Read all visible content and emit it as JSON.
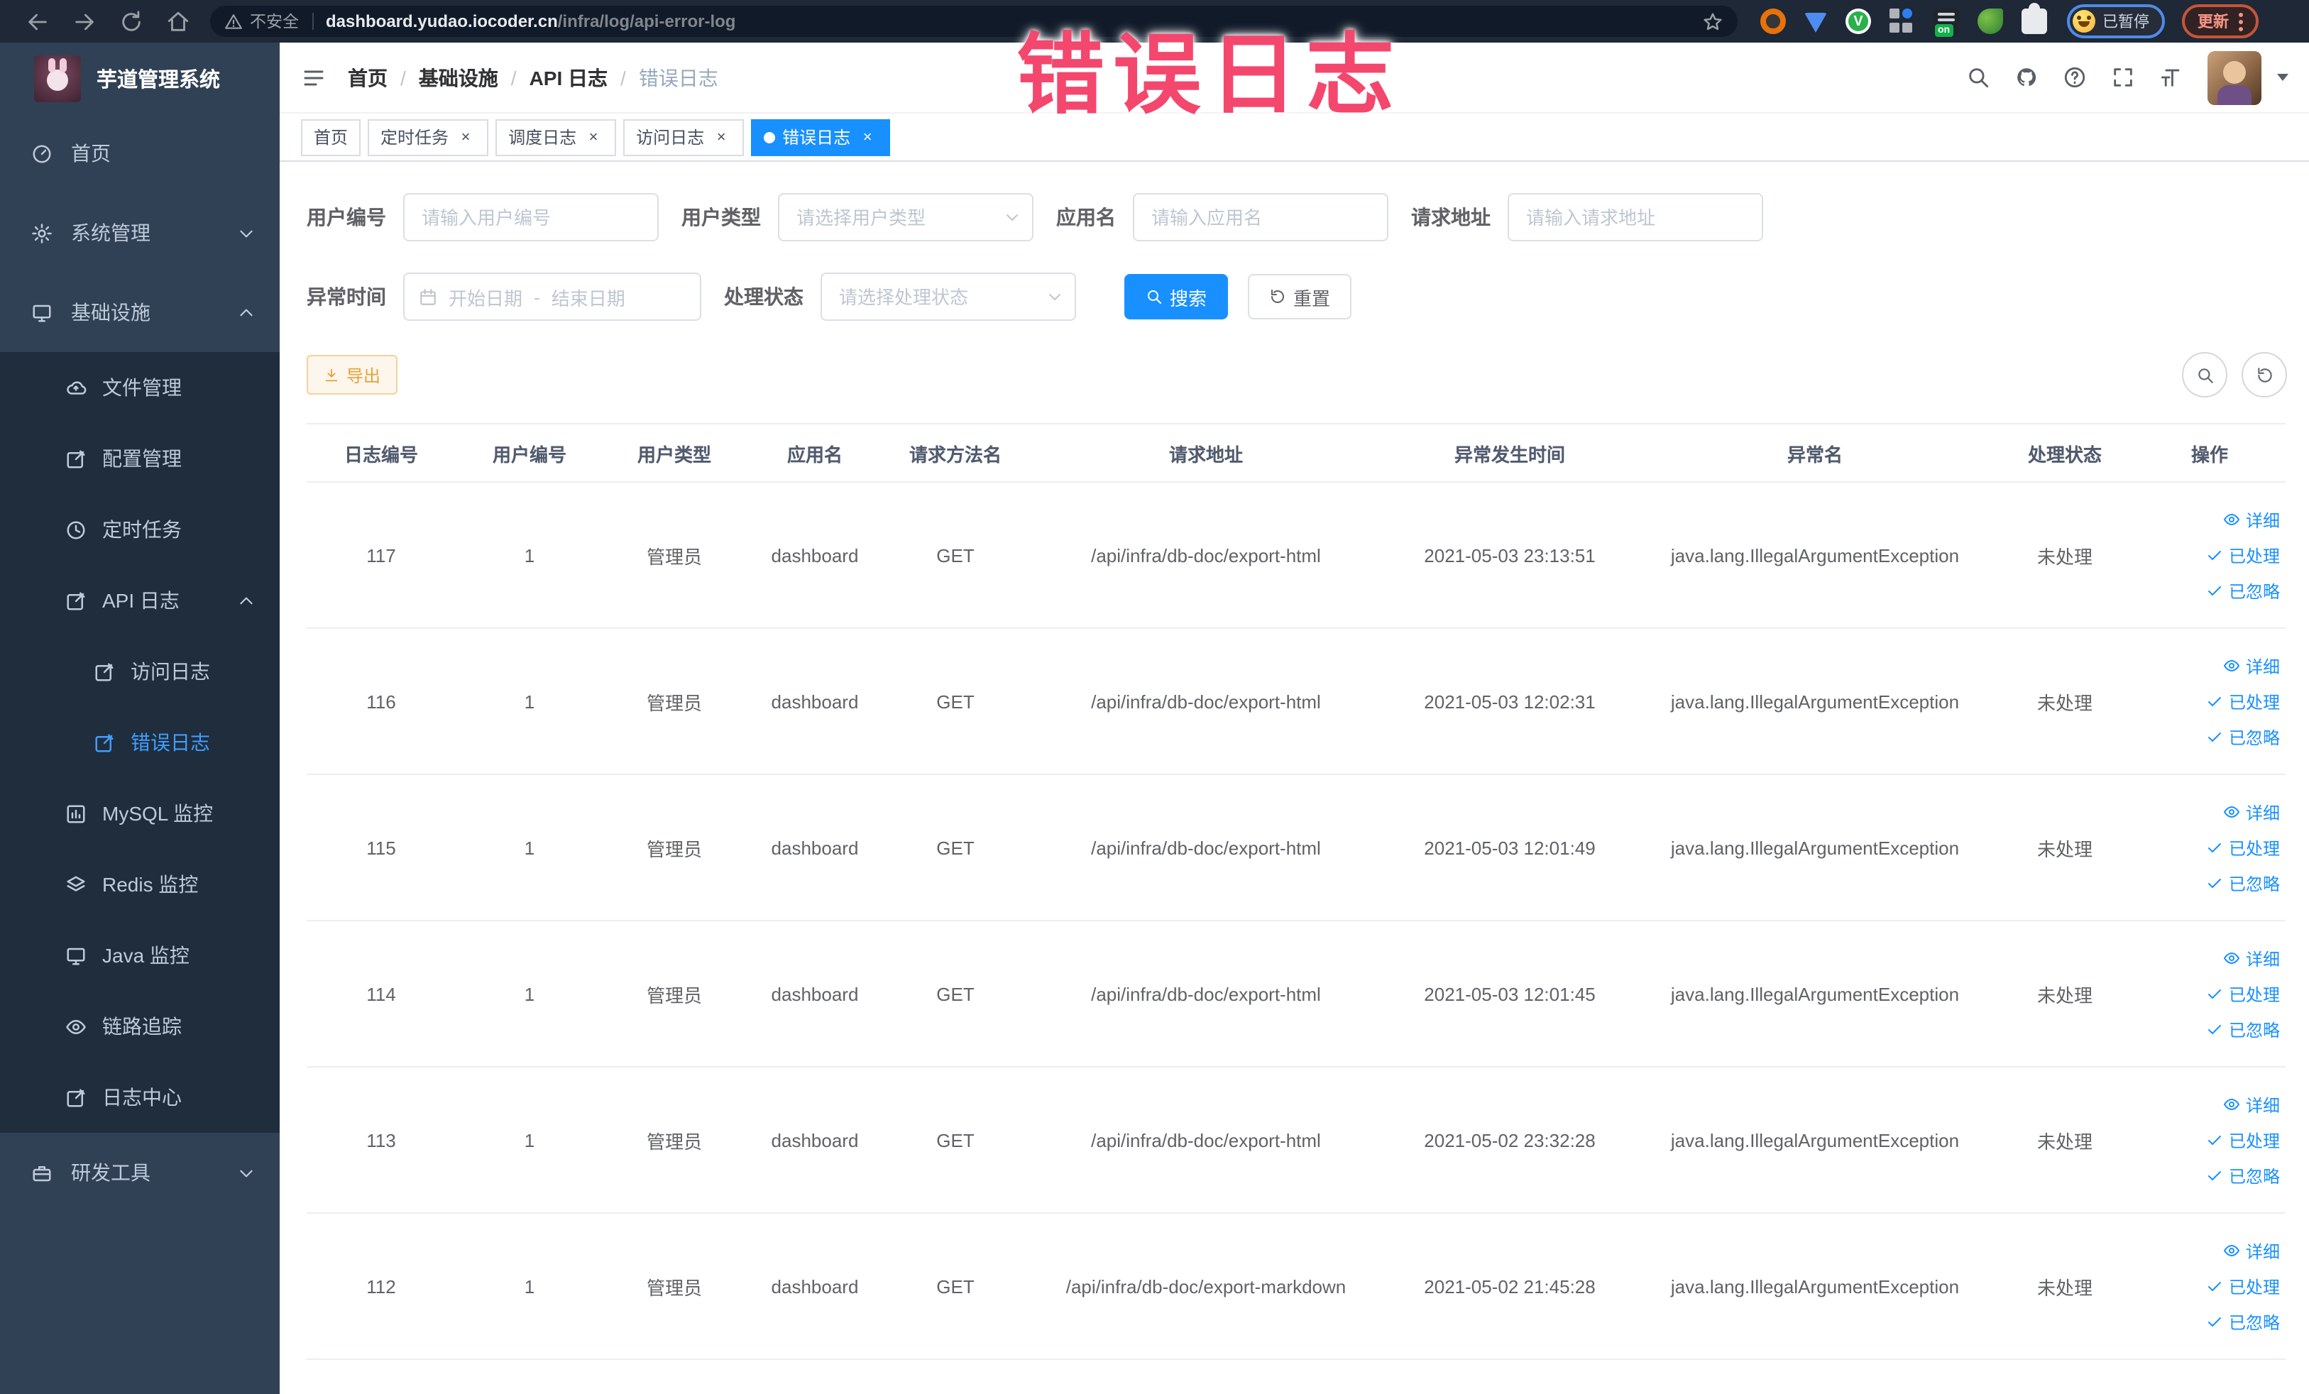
{
  "browser": {
    "security_label": "不安全",
    "url_domain": "dashboard.yudao.iocoder.cn",
    "url_path": "/infra/log/api-error-log",
    "profile_chip_label": "已暂停",
    "update_chip_label": "更新"
  },
  "annotation": {
    "text": "错误日志",
    "color": "#f4476d"
  },
  "sidebar": {
    "title": "芋道管理系统",
    "items": [
      {
        "label": "首页"
      },
      {
        "label": "系统管理"
      },
      {
        "label": "基础设施"
      },
      {
        "label": "文件管理"
      },
      {
        "label": "配置管理"
      },
      {
        "label": "定时任务"
      },
      {
        "label": "API 日志"
      },
      {
        "label": "访问日志"
      },
      {
        "label": "错误日志"
      },
      {
        "label": "MySQL 监控"
      },
      {
        "label": "Redis 监控"
      },
      {
        "label": "Java 监控"
      },
      {
        "label": "链路追踪"
      },
      {
        "label": "日志中心"
      },
      {
        "label": "研发工具"
      }
    ]
  },
  "breadcrumb": {
    "items": [
      "首页",
      "基础设施",
      "API 日志",
      "错误日志"
    ],
    "separator": "/"
  },
  "tabs": [
    {
      "label": "首页"
    },
    {
      "label": "定时任务"
    },
    {
      "label": "调度日志"
    },
    {
      "label": "访问日志"
    },
    {
      "label": "错误日志"
    }
  ],
  "filters": {
    "user_id": {
      "label": "用户编号",
      "placeholder": "请输入用户编号"
    },
    "user_type": {
      "label": "用户类型",
      "placeholder": "请选择用户类型"
    },
    "app_name": {
      "label": "应用名",
      "placeholder": "请输入应用名"
    },
    "request_url": {
      "label": "请求地址",
      "placeholder": "请输入请求地址"
    },
    "exception_time": {
      "label": "异常时间",
      "start_placeholder": "开始日期",
      "separator": "-",
      "end_placeholder": "结束日期"
    },
    "process_status": {
      "label": "处理状态",
      "placeholder": "请选择处理状态"
    },
    "search_label": "搜索",
    "reset_label": "重置"
  },
  "toolbar": {
    "export_label": "导出"
  },
  "table": {
    "headers": [
      "日志编号",
      "用户编号",
      "用户类型",
      "应用名",
      "请求方法名",
      "请求地址",
      "异常发生时间",
      "异常名",
      "处理状态",
      "操作"
    ],
    "row_actions": [
      "详细",
      "已处理",
      "已忽略"
    ],
    "rows": [
      {
        "id": "117",
        "user_id": "1",
        "user_type": "管理员",
        "app_name": "dashboard",
        "method": "GET",
        "url": "/api/infra/db-doc/export-html",
        "time": "2021-05-03 23:13:51",
        "exception": "java.lang.IllegalArgumentException",
        "status": "未处理"
      },
      {
        "id": "116",
        "user_id": "1",
        "user_type": "管理员",
        "app_name": "dashboard",
        "method": "GET",
        "url": "/api/infra/db-doc/export-html",
        "time": "2021-05-03 12:02:31",
        "exception": "java.lang.IllegalArgumentException",
        "status": "未处理"
      },
      {
        "id": "115",
        "user_id": "1",
        "user_type": "管理员",
        "app_name": "dashboard",
        "method": "GET",
        "url": "/api/infra/db-doc/export-html",
        "time": "2021-05-03 12:01:49",
        "exception": "java.lang.IllegalArgumentException",
        "status": "未处理"
      },
      {
        "id": "114",
        "user_id": "1",
        "user_type": "管理员",
        "app_name": "dashboard",
        "method": "GET",
        "url": "/api/infra/db-doc/export-html",
        "time": "2021-05-03 12:01:45",
        "exception": "java.lang.IllegalArgumentException",
        "status": "未处理"
      },
      {
        "id": "113",
        "user_id": "1",
        "user_type": "管理员",
        "app_name": "dashboard",
        "method": "GET",
        "url": "/api/infra/db-doc/export-html",
        "time": "2021-05-02 23:32:28",
        "exception": "java.lang.IllegalArgumentException",
        "status": "未处理"
      },
      {
        "id": "112",
        "user_id": "1",
        "user_type": "管理员",
        "app_name": "dashboard",
        "method": "GET",
        "url": "/api/infra/db-doc/export-markdown",
        "time": "2021-05-02 21:45:28",
        "exception": "java.lang.IllegalArgumentException",
        "status": "未处理"
      }
    ]
  }
}
